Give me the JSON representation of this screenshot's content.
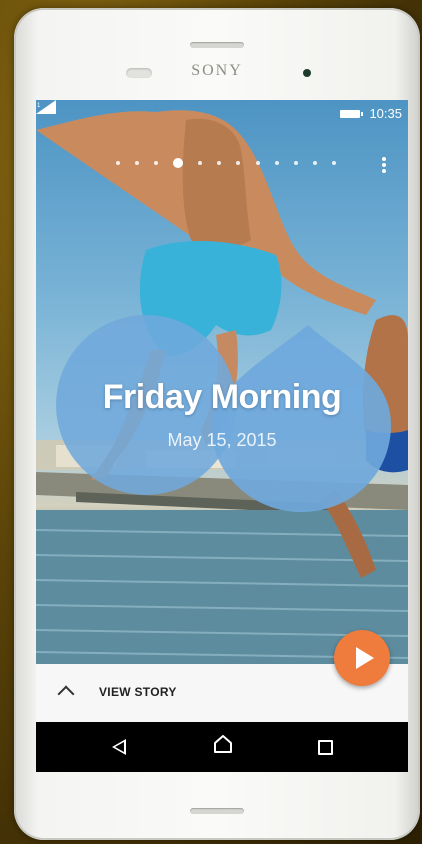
{
  "device": {
    "brand": "SONY"
  },
  "status_bar": {
    "time": "10:35",
    "icons": [
      "signal-icon",
      "battery-icon"
    ]
  },
  "pager": {
    "total": 12,
    "active_index": 3
  },
  "story": {
    "title": "Friday Morning",
    "date": "May 15, 2015"
  },
  "actions": {
    "play_icon": "play-icon",
    "view_story_label": "VIEW STORY",
    "expand_icon": "chevron-up-icon",
    "overflow_icon": "more-vert-icon"
  },
  "nav_bar": {
    "back_icon": "back-icon",
    "home_icon": "home-icon",
    "recent_icon": "recent-apps-icon"
  },
  "colors": {
    "accent": "#ef7c3c",
    "bubble": "#6fa8dc"
  }
}
